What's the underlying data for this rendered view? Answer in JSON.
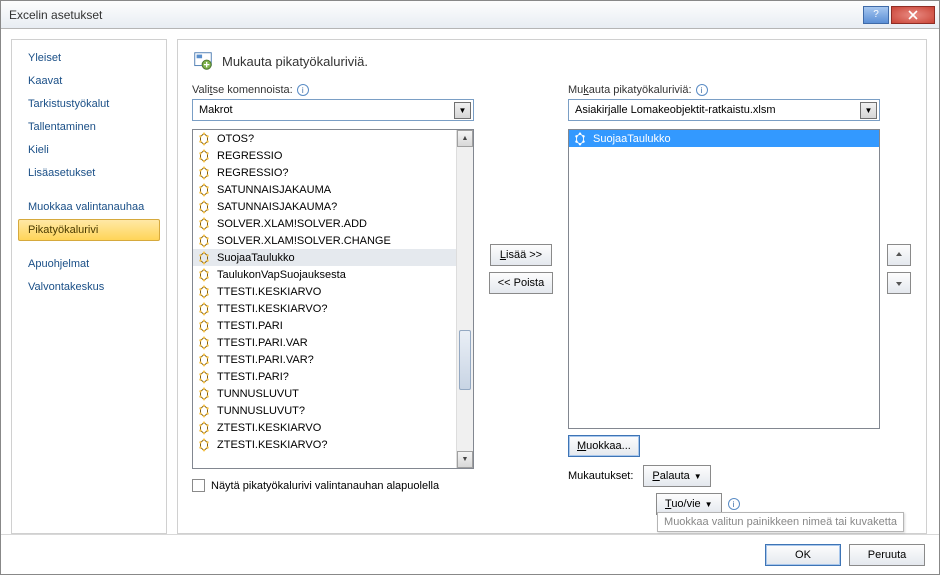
{
  "window": {
    "title": "Excelin asetukset"
  },
  "sidebar": {
    "items": [
      "Yleiset",
      "Kaavat",
      "Tarkistustyökalut",
      "Tallentaminen",
      "Kieli",
      "Lisäasetukset",
      "Muokkaa valintanauhaa",
      "Pikatyökalurivi",
      "Apuohjelmat",
      "Valvontakeskus"
    ],
    "selected_index": 7
  },
  "page": {
    "title": "Mukauta pikatyökaluriviä.",
    "choose_label_pre": "Vali",
    "choose_label_u": "t",
    "choose_label_post": "se komennoista:",
    "choose_value": "Makrot",
    "customize_label_pre": "Mu",
    "customize_label_u": "k",
    "customize_label_post": "auta pikatyökaluriviä:",
    "customize_value": "Asiakirjalle Lomakeobjektit-ratkaistu.xlsm",
    "add_label": "Lisää >>",
    "add_u": "L",
    "remove_label": "<< Poista",
    "modify_label": "Muokkaa...",
    "modify_u": "M",
    "customizations_label": "Mukautukset:",
    "reset_label": "Palauta",
    "reset_u": "P",
    "importexport_label": "uo/vie",
    "importexport_u": "T",
    "checkbox_label": "Näytä pikatyökalurivi valintanauhan alapuolella",
    "tooltip": "Muokkaa valitun painikkeen nimeä tai kuvaketta"
  },
  "left_list": {
    "items": [
      "OTOS?",
      "REGRESSIO",
      "REGRESSIO?",
      "SATUNNAISJAKAUMA",
      "SATUNNAISJAKAUMA?",
      "SOLVER.XLAM!SOLVER.ADD",
      "SOLVER.XLAM!SOLVER.CHANGE",
      "SuojaaTaulukko",
      "TaulukonVapSuojauksesta",
      "TTESTI.KESKIARVO",
      "TTESTI.KESKIARVO?",
      "TTESTI.PARI",
      "TTESTI.PARI.VAR",
      "TTESTI.PARI.VAR?",
      "TTESTI.PARI?",
      "TUNNUSLUVUT",
      "TUNNUSLUVUT?",
      "ZTESTI.KESKIARVO",
      "ZTESTI.KESKIARVO?"
    ],
    "selected_index": 7
  },
  "right_list": {
    "items": [
      "SuojaaTaulukko"
    ],
    "highlighted_index": 0
  },
  "footer": {
    "ok": "OK",
    "cancel": "Peruuta"
  }
}
